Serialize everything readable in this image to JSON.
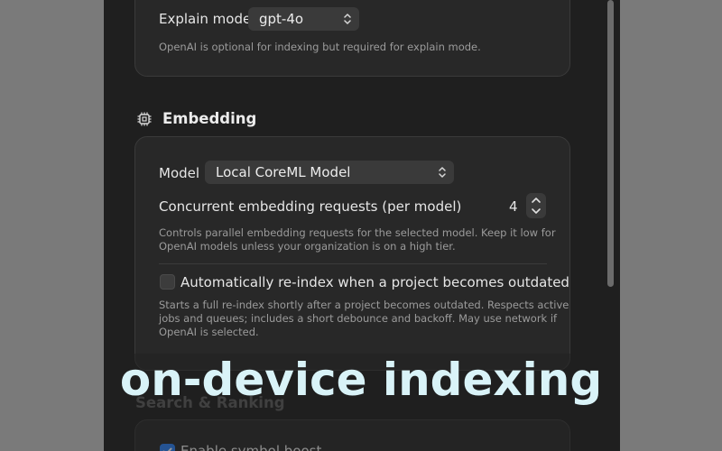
{
  "openai_card": {
    "explain_mode_label": "Explain mode",
    "explain_mode_value": "gpt-4o",
    "note": "OpenAI is optional for indexing but required for explain mode."
  },
  "embedding": {
    "title": "Embedding",
    "model_label": "Model",
    "model_value": "Local CoreML Model",
    "concurrent_label": "Concurrent embedding requests (per model)",
    "concurrent_value": "4",
    "concurrent_desc_line1": "Controls parallel embedding requests for the selected model. Keep it low for",
    "concurrent_desc_line2": "OpenAI models unless your organization is on a high tier.",
    "reindex_label": "Automatically re-index when a project becomes outdated",
    "reindex_checked": false,
    "reindex_desc_line1": "Starts a full re-index shortly after a project becomes outdated. Respects active",
    "reindex_desc_line2": "jobs and queues; includes a short debounce and backoff. May use network if",
    "reindex_desc_line3": "OpenAI is selected."
  },
  "search_ranking": {
    "title": "Search & Ranking",
    "symbol_boost_label": "Enable symbol boost",
    "symbol_boost_checked": true
  },
  "caption": "on-device indexing",
  "colors": {
    "background": "#7a7a7a",
    "window": "#1f1f1f",
    "card": "#282828",
    "accent": "#2a7ff0",
    "caption": "#d9f3f8"
  }
}
